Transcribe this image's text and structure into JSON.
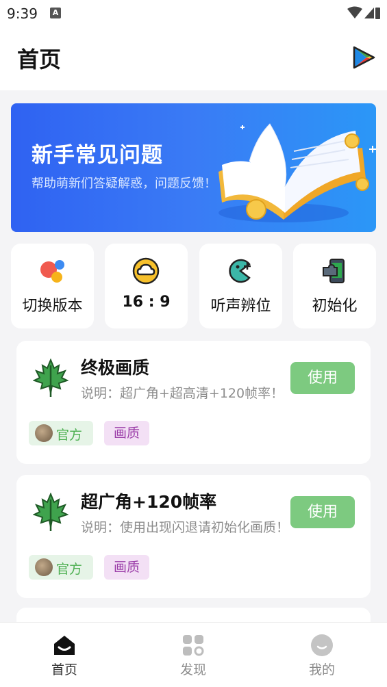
{
  "status_bar": {
    "time": "9:39",
    "indicator": "A"
  },
  "header": {
    "title": "首页"
  },
  "banner": {
    "title": "新手常见问题",
    "subtitle": "帮助萌新们答疑解惑，问题反馈！"
  },
  "shortcuts": [
    {
      "label": "切换版本",
      "icon": "switch-version-icon"
    },
    {
      "label": "16 : 9",
      "icon": "cloud-icon"
    },
    {
      "label": "听声辨位",
      "icon": "sound-locate-icon"
    },
    {
      "label": "初始化",
      "icon": "puzzle-phone-icon"
    }
  ],
  "cards": [
    {
      "title": "终极画质",
      "desc": "说明：超广角+超高清+120帧率！",
      "button": "使用",
      "tag_official": "官方",
      "tag_type": "画质"
    },
    {
      "title": "超广角+120帧率",
      "desc": "说明：使用出现闪退请初始化画质！",
      "button": "使用",
      "tag_official": "官方",
      "tag_type": "画质"
    }
  ],
  "nav": {
    "items": [
      {
        "label": "首页"
      },
      {
        "label": "发现"
      },
      {
        "label": "我的"
      }
    ]
  },
  "colors": {
    "accent_green": "#7dca80",
    "banner_blue": "#3a7bf5",
    "tag_purple": "#9c3fa9"
  }
}
